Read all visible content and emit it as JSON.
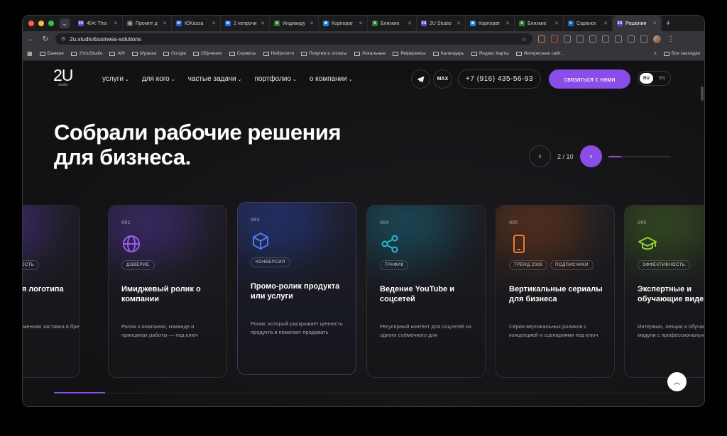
{
  "browser": {
    "tabs": [
      {
        "label": "404: This",
        "favicon": "2U",
        "color": "#6b3fd0"
      },
      {
        "label": "Промпт д",
        "favicon": "◎",
        "color": "#555"
      },
      {
        "label": "ЮKassa",
        "favicon": "Ю",
        "color": "#2a5bd7"
      },
      {
        "label": "2 непрочи",
        "favicon": "✉",
        "color": "#1a73e8"
      },
      {
        "label": "Индивиду",
        "favicon": "A",
        "color": "#2e7d32"
      },
      {
        "label": "Корпорат",
        "favicon": "✖",
        "color": "#1e88e5"
      },
      {
        "label": "Близкие",
        "favicon": "A",
        "color": "#2e7d32"
      },
      {
        "label": "2U Studio",
        "favicon": "2U",
        "color": "#6b3fd0"
      },
      {
        "label": "Корпорат",
        "favicon": "✖",
        "color": "#1e88e5"
      },
      {
        "label": "Близкие",
        "favicon": "A",
        "color": "#2e7d32"
      },
      {
        "label": "Саранск",
        "favicon": "✈",
        "color": "#1565c0"
      },
      {
        "label": "Решения",
        "favicon": "2U",
        "color": "#6b3fd0",
        "active": true
      }
    ],
    "url": "2u.studio/business-solutions",
    "bookmarks": [
      "Банкинг",
      "2YouStudio",
      "API",
      "Музыка",
      "Google",
      "Обучение",
      "Сервисы",
      "Нейросети",
      "Покупки и оплаты",
      "Локальные",
      "Референсы",
      "Календарь",
      "Яндекс Карты",
      "Интересные сайт..."
    ],
    "all_bookmarks": "Все закладки"
  },
  "site": {
    "logo": "2U",
    "logo_sub": "studio",
    "nav": [
      "услуги",
      "для кого",
      "частые задачи",
      "портфолио",
      "о компании"
    ],
    "max_label": "MAX",
    "phone": "+7 (916) 435-56-93",
    "contact_label": "связаться с нами",
    "lang_active": "RU",
    "lang_other": "EN",
    "headline_1": "Собрали рабочие решения",
    "headline_2": "для бизнеса.",
    "pager": "2 / 10",
    "pager_progress": 0.2,
    "accent_color": "#8a4de8"
  },
  "cards": [
    {
      "num": "",
      "tags": [
        "ность"
      ],
      "title": "ия логотипа",
      "desc": "ирменная заставка в бренда для всех ю",
      "icon": "",
      "glow": "#6b3fd0"
    },
    {
      "num": "002",
      "tags": [
        "доверие"
      ],
      "title": "Имиджевый ролик о компании",
      "desc": "Ролик о компании, команде и принципах работы — под ключ",
      "icon": "globe-icon",
      "color": "#9b5cf0",
      "glow": "#6b3fd0"
    },
    {
      "num": "003",
      "tags": [
        "конверсия"
      ],
      "title": "Промо-ролик продукта или услуги",
      "desc": "Ролик, который раскрывает ценность продукта и помогает продавать",
      "icon": "box-icon",
      "color": "#4a7df0",
      "glow": "#2e4fd0"
    },
    {
      "num": "004",
      "tags": [
        "трафик"
      ],
      "title": "Ведение YouTube и соцсетей",
      "desc": "Регулярный контент для соцсетей из одного съёмочного дня",
      "icon": "share-icon",
      "color": "#2bb5d8",
      "glow": "#1a8fb0"
    },
    {
      "num": "005",
      "tags": [
        "тренд 2026",
        "подписчики"
      ],
      "title": "Вертикальные сериалы для бизнеса",
      "desc": "Серия вертикальных роликов с концепцией и сценариями под ключ",
      "icon": "phone-icon",
      "color": "#f07a2e",
      "glow": "#b0501a"
    },
    {
      "num": "006",
      "tags": [
        "эффективность"
      ],
      "title": "Экспертные и обучающие виде",
      "desc": "Интервью, лекции и обучающие модули с профессиональной съё",
      "icon": "graduation-cap-icon",
      "color": "#8fd03a",
      "glow": "#5a9020"
    }
  ]
}
